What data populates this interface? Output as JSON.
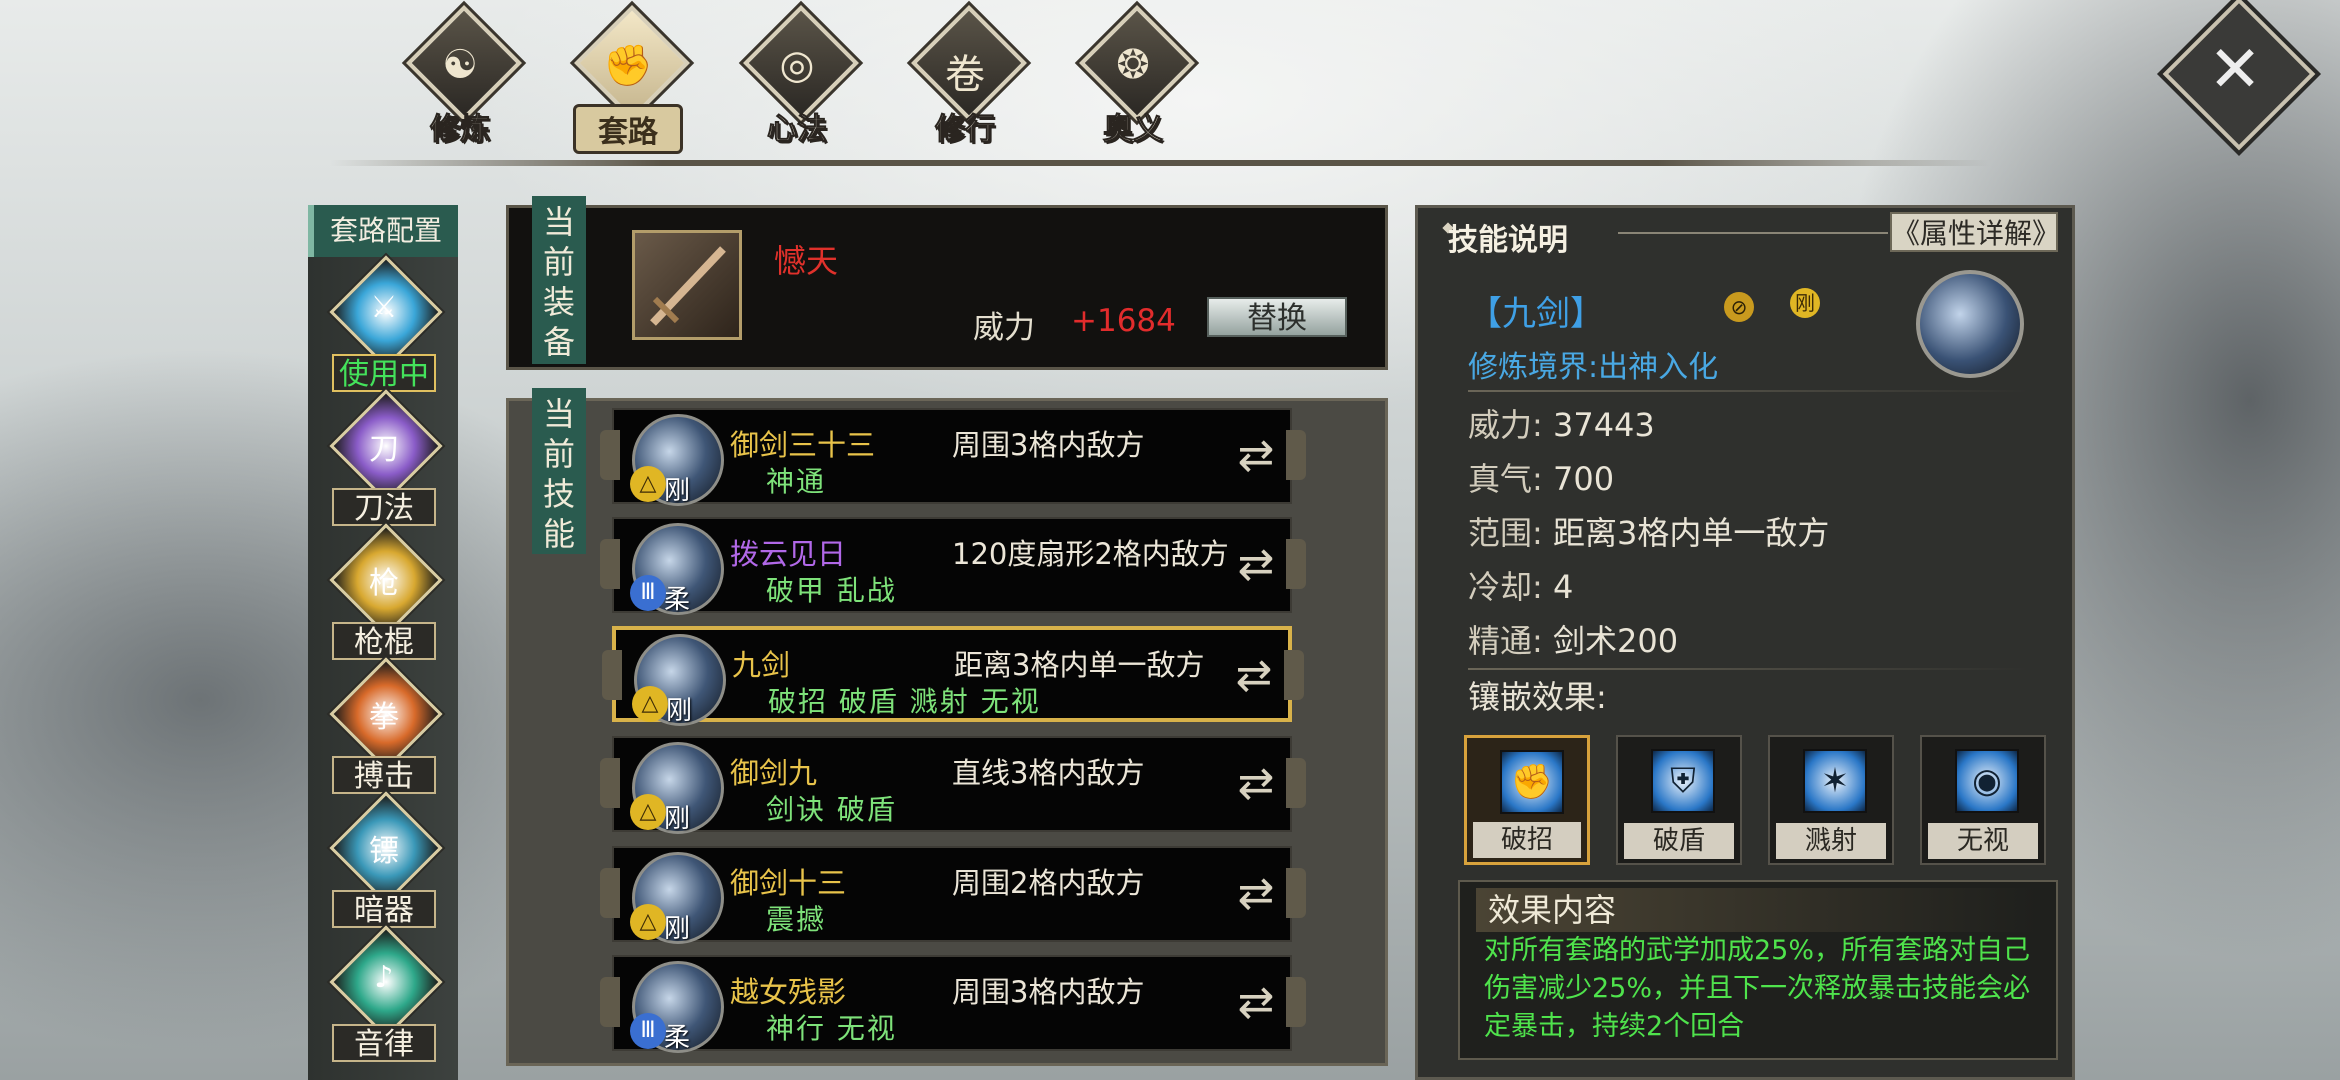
{
  "nav": {
    "tabs": [
      {
        "label": "修炼",
        "glyph": "☯",
        "active": false
      },
      {
        "label": "套路",
        "glyph": "✊",
        "active": true
      },
      {
        "label": "心法",
        "glyph": "◎",
        "active": false
      },
      {
        "label": "修行",
        "glyph": "卷",
        "active": false
      },
      {
        "label": "奥义",
        "glyph": "❂",
        "active": false
      }
    ],
    "close_glyph": "✕"
  },
  "sidebar": {
    "title": "套路配置",
    "items": [
      {
        "label": "使用中",
        "icon": "sword-icon",
        "glyph": "⚔",
        "color": "#3aa6d8",
        "active": true
      },
      {
        "label": "刀法",
        "icon": "blade-icon",
        "glyph": "刀",
        "color": "#8a5cc8"
      },
      {
        "label": "枪棍",
        "icon": "spear-icon",
        "glyph": "枪",
        "color": "#d8a830"
      },
      {
        "label": "搏击",
        "icon": "fist-icon",
        "glyph": "拳",
        "color": "#d86a2a"
      },
      {
        "label": "暗器",
        "icon": "dart-icon",
        "glyph": "镖",
        "color": "#3a98b8"
      },
      {
        "label": "音律",
        "icon": "music-icon",
        "glyph": "♪",
        "color": "#2ea88a"
      }
    ]
  },
  "equipment": {
    "section_label": "当前装备",
    "weapon_name": "憾天",
    "power_label": "威力",
    "power_bonus": "+1684",
    "replace_label": "替换",
    "name_color": "#e0312b"
  },
  "skills": {
    "section_label": "当前技能",
    "rows": [
      {
        "name": "御剑三十三",
        "tags": "神通",
        "range": "周围3格内敌方",
        "type": "刚",
        "badge": "yellow",
        "name_color": "yellow"
      },
      {
        "name": "拨云见日",
        "tags": "破甲 乱战",
        "range": "120度扇形2格内敌方",
        "type": "柔",
        "badge": "blue",
        "name_color": "purple"
      },
      {
        "name": "九剑",
        "tags": "破招 破盾 溅射 无视",
        "range": "距离3格内单一敌方",
        "type": "刚",
        "badge": "yellow",
        "name_color": "yellow",
        "selected": true
      },
      {
        "name": "御剑九",
        "tags": "剑诀 破盾",
        "range": "直线3格内敌方",
        "type": "刚",
        "badge": "yellow",
        "name_color": "yellow"
      },
      {
        "name": "御剑十三",
        "tags": "震撼",
        "range": "周围2格内敌方",
        "type": "刚",
        "badge": "yellow",
        "name_color": "yellow"
      },
      {
        "name": "越女残影",
        "tags": "神行 无视",
        "range": "周围3格内敌方",
        "type": "柔",
        "badge": "blue",
        "name_color": "yellow"
      }
    ]
  },
  "info": {
    "title": "技能说明",
    "attr_button": "《属性详解》",
    "skill_name": "【九剑】",
    "badge_type": "刚",
    "realm": "修炼境界:出神入化",
    "stats": [
      {
        "key": "威力:",
        "value": "37443"
      },
      {
        "key": "真气:",
        "value": "700"
      },
      {
        "key": "范围:",
        "value": "距离3格内单一敌方"
      },
      {
        "key": "冷却:",
        "value": "4"
      },
      {
        "key": "精通:",
        "value": "剑术200"
      }
    ],
    "inlay_label": "镶嵌效果:",
    "inlays": [
      {
        "label": "破招",
        "glyph": "✊",
        "selected": true
      },
      {
        "label": "破盾",
        "glyph": "⛨"
      },
      {
        "label": "溅射",
        "glyph": "✶"
      },
      {
        "label": "无视",
        "glyph": "◉"
      }
    ],
    "effect_title": "效果内容",
    "effect_text": "对所有套路的武学加成25%，所有套路对自己伤害减少25%，并且下一次释放暴击技能会必定暴击，持续2个回合"
  }
}
